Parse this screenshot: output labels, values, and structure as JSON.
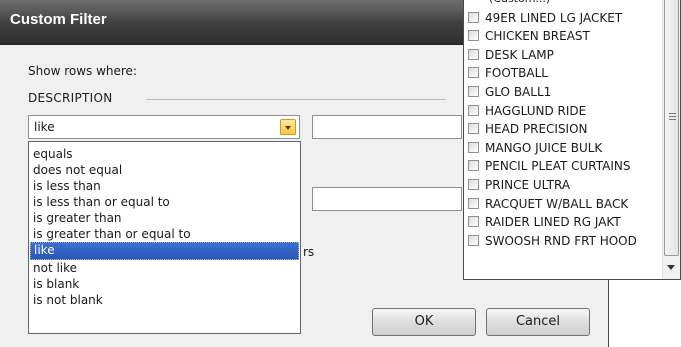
{
  "dialog": {
    "title": "Custom Filter",
    "show_rows_label": "Show rows where:",
    "column_name": "DESCRIPTION",
    "operator_value": "like",
    "partial_text": "rs",
    "ok_label": "OK",
    "cancel_label": "Cancel"
  },
  "operator_options": [
    "equals",
    "does not equal",
    "is less than",
    "is less than or equal to",
    "is greater than",
    "is greater than or equal to",
    "like",
    "not like",
    "is blank",
    "is not blank"
  ],
  "selected_operator_index": 6,
  "value_list": {
    "items": [
      "(Custom...)",
      "49ER LINED LG JACKET",
      "CHICKEN BREAST",
      "DESK LAMP",
      "FOOTBALL",
      "GLO BALL1",
      "HAGGLUND RIDE",
      "HEAD PRECISION",
      "MANGO JUICE BULK",
      "PENCIL PLEAT CURTAINS",
      "PRINCE ULTRA",
      "RACQUET W/BALL BACK",
      "RAIDER LINED RG JAKT",
      "SWOOSH RND FRT HOOD"
    ]
  },
  "colors": {
    "titlebar": "#3f3f3f",
    "selection": "#2a56b5",
    "dropdown_arrow": "#ffc53d"
  }
}
